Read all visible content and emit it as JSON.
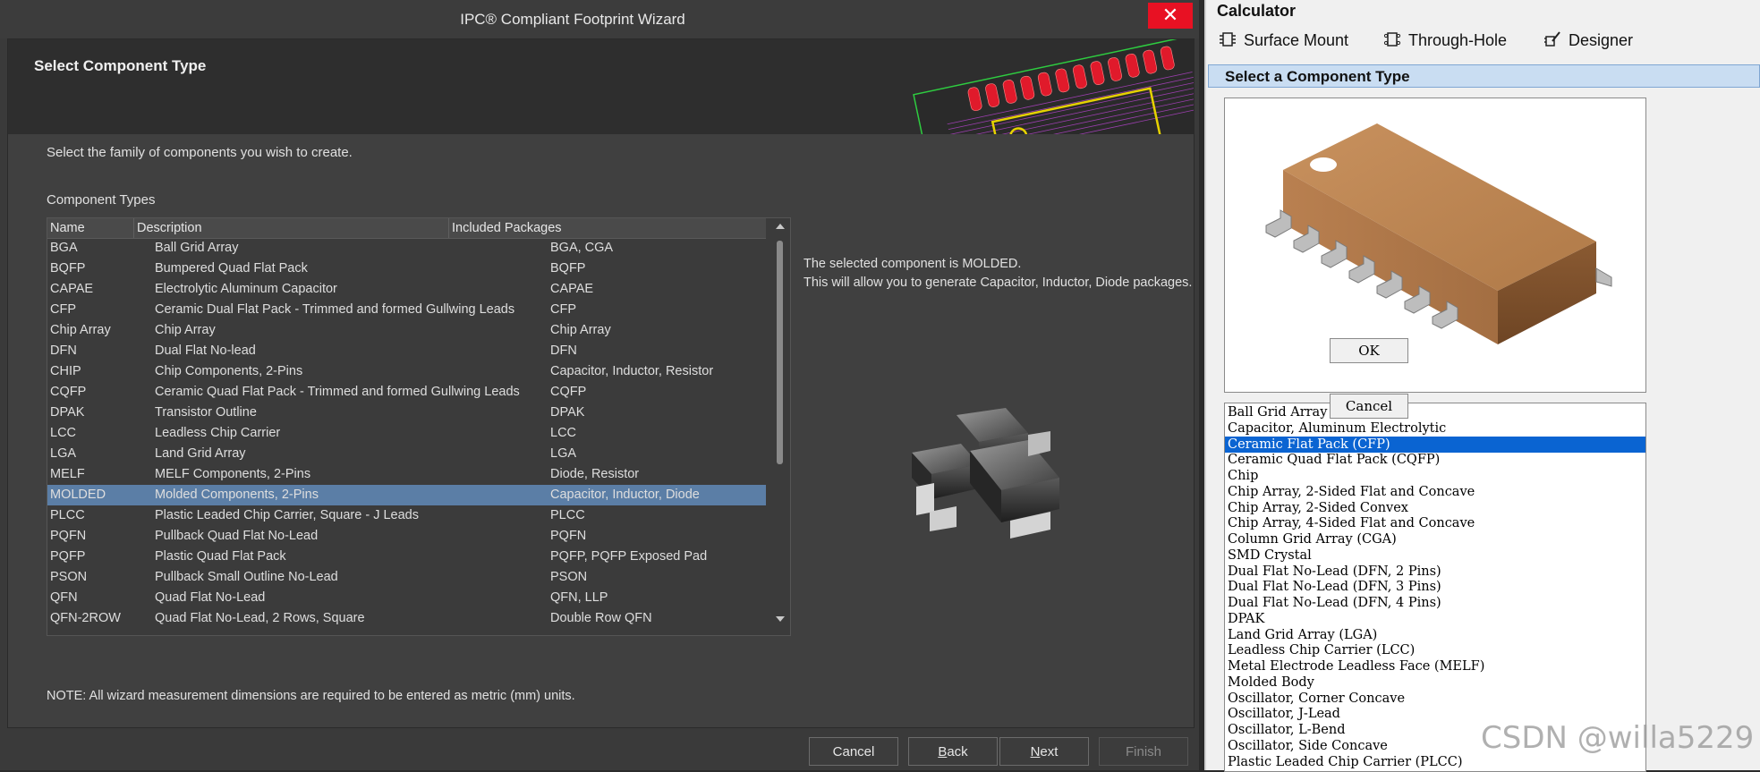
{
  "wizard": {
    "title": "IPC® Compliant Footprint Wizard",
    "close_glyph": "✕",
    "header_title": "Select Component Type",
    "instruction": "Select the family of components you wish to create.",
    "types_label": "Component Types",
    "table": {
      "headers": [
        "Name",
        "Description",
        "Included Packages"
      ],
      "rows": [
        {
          "name": "BGA",
          "desc": "Ball Grid Array",
          "pkgs": "BGA, CGA"
        },
        {
          "name": "BQFP",
          "desc": "Bumpered Quad Flat Pack",
          "pkgs": "BQFP"
        },
        {
          "name": "CAPAE",
          "desc": "Electrolytic Aluminum Capacitor",
          "pkgs": "CAPAE"
        },
        {
          "name": "CFP",
          "desc": "Ceramic Dual Flat Pack - Trimmed and formed Gullwing Leads",
          "pkgs": "CFP"
        },
        {
          "name": "Chip Array",
          "desc": "Chip Array",
          "pkgs": "Chip Array"
        },
        {
          "name": "DFN",
          "desc": "Dual Flat No-lead",
          "pkgs": "DFN"
        },
        {
          "name": "CHIP",
          "desc": "Chip Components, 2-Pins",
          "pkgs": "Capacitor, Inductor, Resistor"
        },
        {
          "name": "CQFP",
          "desc": "Ceramic Quad Flat Pack - Trimmed and formed Gullwing Leads",
          "pkgs": "CQFP"
        },
        {
          "name": "DPAK",
          "desc": "Transistor Outline",
          "pkgs": "DPAK"
        },
        {
          "name": "LCC",
          "desc": "Leadless Chip Carrier",
          "pkgs": "LCC"
        },
        {
          "name": "LGA",
          "desc": "Land Grid Array",
          "pkgs": "LGA"
        },
        {
          "name": "MELF",
          "desc": "MELF Components, 2-Pins",
          "pkgs": "Diode, Resistor"
        },
        {
          "name": "MOLDED",
          "desc": "Molded Components, 2-Pins",
          "pkgs": "Capacitor, Inductor, Diode"
        },
        {
          "name": "PLCC",
          "desc": "Plastic Leaded Chip Carrier, Square - J Leads",
          "pkgs": "PLCC"
        },
        {
          "name": "PQFN",
          "desc": "Pullback Quad Flat No-Lead",
          "pkgs": "PQFN"
        },
        {
          "name": "PQFP",
          "desc": "Plastic Quad Flat Pack",
          "pkgs": "PQFP, PQFP Exposed Pad"
        },
        {
          "name": "PSON",
          "desc": "Pullback Small Outline No-Lead",
          "pkgs": "PSON"
        },
        {
          "name": "QFN",
          "desc": "Quad Flat No-Lead",
          "pkgs": "QFN, LLP"
        },
        {
          "name": "QFN-2ROW",
          "desc": "Quad Flat No-Lead, 2 Rows, Square",
          "pkgs": "Double Row QFN"
        }
      ],
      "selected_index": 12
    },
    "selection_info_1": "The selected component is MOLDED.",
    "selection_info_2": "This will allow you to generate Capacitor, Inductor, Diode packages.",
    "note": "NOTE: All wizard measurement dimensions are required to be entered as metric (mm) units.",
    "buttons": {
      "cancel": "Cancel",
      "back_b": "B",
      "back_rest": "ack",
      "next_n": "N",
      "next_rest": "ext",
      "finish": "Finish"
    }
  },
  "calculator": {
    "title": "Calculator",
    "tabs": [
      "Surface Mount",
      "Through-Hole",
      "Designer"
    ],
    "section": "Select a Component Type",
    "list": [
      "Ball Grid Array (BGA)",
      "Capacitor, Aluminum Electrolytic",
      "Ceramic Flat Pack (CFP)",
      "Ceramic Quad Flat Pack (CQFP)",
      "Chip",
      "Chip Array, 2-Sided Flat and Concave",
      "Chip Array, 2-Sided Convex",
      "Chip Array, 4-Sided Flat and Concave",
      "Column Grid Array (CGA)",
      "SMD Crystal",
      "Dual Flat No-Lead (DFN, 2 Pins)",
      "Dual Flat No-Lead (DFN, 3 Pins)",
      "Dual Flat No-Lead (DFN, 4 Pins)",
      "DPAK",
      "Land Grid Array (LGA)",
      "Leadless Chip Carrier (LCC)",
      "Metal Electrode Leadless Face (MELF)",
      "Molded Body",
      "Oscillator, Corner Concave",
      "Oscillator, J-Lead",
      "Oscillator, L-Bend",
      "Oscillator, Side Concave",
      "Plastic Leaded Chip Carrier (PLCC)"
    ],
    "selected_index": 2,
    "ok": "OK",
    "cancel": "Cancel"
  },
  "watermark": "CSDN @willa5229",
  "colors": {
    "selection_dark": "#5b7ea6",
    "selection_light": "#0a64d2",
    "close_red": "#e81123"
  }
}
